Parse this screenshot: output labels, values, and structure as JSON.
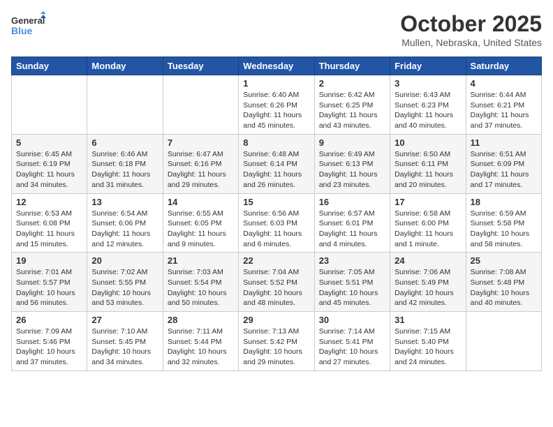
{
  "header": {
    "logo_line1": "General",
    "logo_line2": "Blue",
    "title": "October 2025",
    "subtitle": "Mullen, Nebraska, United States"
  },
  "weekdays": [
    "Sunday",
    "Monday",
    "Tuesday",
    "Wednesday",
    "Thursday",
    "Friday",
    "Saturday"
  ],
  "weeks": [
    [
      {
        "day": "",
        "info": ""
      },
      {
        "day": "",
        "info": ""
      },
      {
        "day": "",
        "info": ""
      },
      {
        "day": "1",
        "info": "Sunrise: 6:40 AM\nSunset: 6:26 PM\nDaylight: 11 hours\nand 45 minutes."
      },
      {
        "day": "2",
        "info": "Sunrise: 6:42 AM\nSunset: 6:25 PM\nDaylight: 11 hours\nand 43 minutes."
      },
      {
        "day": "3",
        "info": "Sunrise: 6:43 AM\nSunset: 6:23 PM\nDaylight: 11 hours\nand 40 minutes."
      },
      {
        "day": "4",
        "info": "Sunrise: 6:44 AM\nSunset: 6:21 PM\nDaylight: 11 hours\nand 37 minutes."
      }
    ],
    [
      {
        "day": "5",
        "info": "Sunrise: 6:45 AM\nSunset: 6:19 PM\nDaylight: 11 hours\nand 34 minutes."
      },
      {
        "day": "6",
        "info": "Sunrise: 6:46 AM\nSunset: 6:18 PM\nDaylight: 11 hours\nand 31 minutes."
      },
      {
        "day": "7",
        "info": "Sunrise: 6:47 AM\nSunset: 6:16 PM\nDaylight: 11 hours\nand 29 minutes."
      },
      {
        "day": "8",
        "info": "Sunrise: 6:48 AM\nSunset: 6:14 PM\nDaylight: 11 hours\nand 26 minutes."
      },
      {
        "day": "9",
        "info": "Sunrise: 6:49 AM\nSunset: 6:13 PM\nDaylight: 11 hours\nand 23 minutes."
      },
      {
        "day": "10",
        "info": "Sunrise: 6:50 AM\nSunset: 6:11 PM\nDaylight: 11 hours\nand 20 minutes."
      },
      {
        "day": "11",
        "info": "Sunrise: 6:51 AM\nSunset: 6:09 PM\nDaylight: 11 hours\nand 17 minutes."
      }
    ],
    [
      {
        "day": "12",
        "info": "Sunrise: 6:53 AM\nSunset: 6:08 PM\nDaylight: 11 hours\nand 15 minutes."
      },
      {
        "day": "13",
        "info": "Sunrise: 6:54 AM\nSunset: 6:06 PM\nDaylight: 11 hours\nand 12 minutes."
      },
      {
        "day": "14",
        "info": "Sunrise: 6:55 AM\nSunset: 6:05 PM\nDaylight: 11 hours\nand 9 minutes."
      },
      {
        "day": "15",
        "info": "Sunrise: 6:56 AM\nSunset: 6:03 PM\nDaylight: 11 hours\nand 6 minutes."
      },
      {
        "day": "16",
        "info": "Sunrise: 6:57 AM\nSunset: 6:01 PM\nDaylight: 11 hours\nand 4 minutes."
      },
      {
        "day": "17",
        "info": "Sunrise: 6:58 AM\nSunset: 6:00 PM\nDaylight: 11 hours\nand 1 minute."
      },
      {
        "day": "18",
        "info": "Sunrise: 6:59 AM\nSunset: 5:58 PM\nDaylight: 10 hours\nand 58 minutes."
      }
    ],
    [
      {
        "day": "19",
        "info": "Sunrise: 7:01 AM\nSunset: 5:57 PM\nDaylight: 10 hours\nand 56 minutes."
      },
      {
        "day": "20",
        "info": "Sunrise: 7:02 AM\nSunset: 5:55 PM\nDaylight: 10 hours\nand 53 minutes."
      },
      {
        "day": "21",
        "info": "Sunrise: 7:03 AM\nSunset: 5:54 PM\nDaylight: 10 hours\nand 50 minutes."
      },
      {
        "day": "22",
        "info": "Sunrise: 7:04 AM\nSunset: 5:52 PM\nDaylight: 10 hours\nand 48 minutes."
      },
      {
        "day": "23",
        "info": "Sunrise: 7:05 AM\nSunset: 5:51 PM\nDaylight: 10 hours\nand 45 minutes."
      },
      {
        "day": "24",
        "info": "Sunrise: 7:06 AM\nSunset: 5:49 PM\nDaylight: 10 hours\nand 42 minutes."
      },
      {
        "day": "25",
        "info": "Sunrise: 7:08 AM\nSunset: 5:48 PM\nDaylight: 10 hours\nand 40 minutes."
      }
    ],
    [
      {
        "day": "26",
        "info": "Sunrise: 7:09 AM\nSunset: 5:46 PM\nDaylight: 10 hours\nand 37 minutes."
      },
      {
        "day": "27",
        "info": "Sunrise: 7:10 AM\nSunset: 5:45 PM\nDaylight: 10 hours\nand 34 minutes."
      },
      {
        "day": "28",
        "info": "Sunrise: 7:11 AM\nSunset: 5:44 PM\nDaylight: 10 hours\nand 32 minutes."
      },
      {
        "day": "29",
        "info": "Sunrise: 7:13 AM\nSunset: 5:42 PM\nDaylight: 10 hours\nand 29 minutes."
      },
      {
        "day": "30",
        "info": "Sunrise: 7:14 AM\nSunset: 5:41 PM\nDaylight: 10 hours\nand 27 minutes."
      },
      {
        "day": "31",
        "info": "Sunrise: 7:15 AM\nSunset: 5:40 PM\nDaylight: 10 hours\nand 24 minutes."
      },
      {
        "day": "",
        "info": ""
      }
    ]
  ]
}
